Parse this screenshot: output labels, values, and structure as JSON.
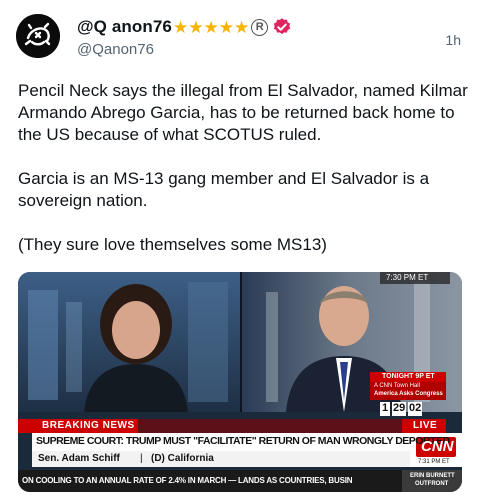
{
  "author": {
    "display_name": "@Q anon76",
    "stars": [
      "★",
      "★",
      "★",
      "★",
      "★"
    ],
    "registered_mark": "R",
    "handle": "@Qanon76",
    "timestamp": "1h"
  },
  "post": {
    "paragraphs": [
      "Pencil Neck says the illegal from El Salvador, named Kilmar Armando Abrego Garcia, has to be returned back home to the US because of what SCOTUS ruled.",
      "Garcia is an MS-13 gang member and El Salvador is a sovereign nation.",
      "(They sure love themselves some MS13)"
    ]
  },
  "video": {
    "clock": "7:30 PM ET",
    "tonight_label": "TONIGHT 9P ET",
    "town_hall_line1": "A CNN Town Hall",
    "town_hall_line2": "America Asks Congress",
    "countdown": [
      "1",
      "29",
      "02"
    ],
    "breaking_news": "BREAKING NEWS",
    "live": "LIVE",
    "headline": "SUPREME COURT: TRUMP MUST \"FACILITATE\" RETURN OF MAN WRONGLY DEPORTED",
    "speaker": "Sen. Adam Schiff",
    "speaker_party": "(D) California",
    "network_logo": "CNN",
    "logo_time": "7:31 PM ET",
    "ticker": "ON COOLING TO AN ANNUAL RATE OF 2.4% IN MARCH — LANDS AS COUNTRIES, BUSIN",
    "next_show_line1": "ERIN BURNETT",
    "next_show_line2": "OUTFRONT"
  },
  "colors": {
    "star": "#f4b400",
    "verified": "#e0245e",
    "cnn_red": "#cc0000",
    "handle_gray": "#536471"
  }
}
